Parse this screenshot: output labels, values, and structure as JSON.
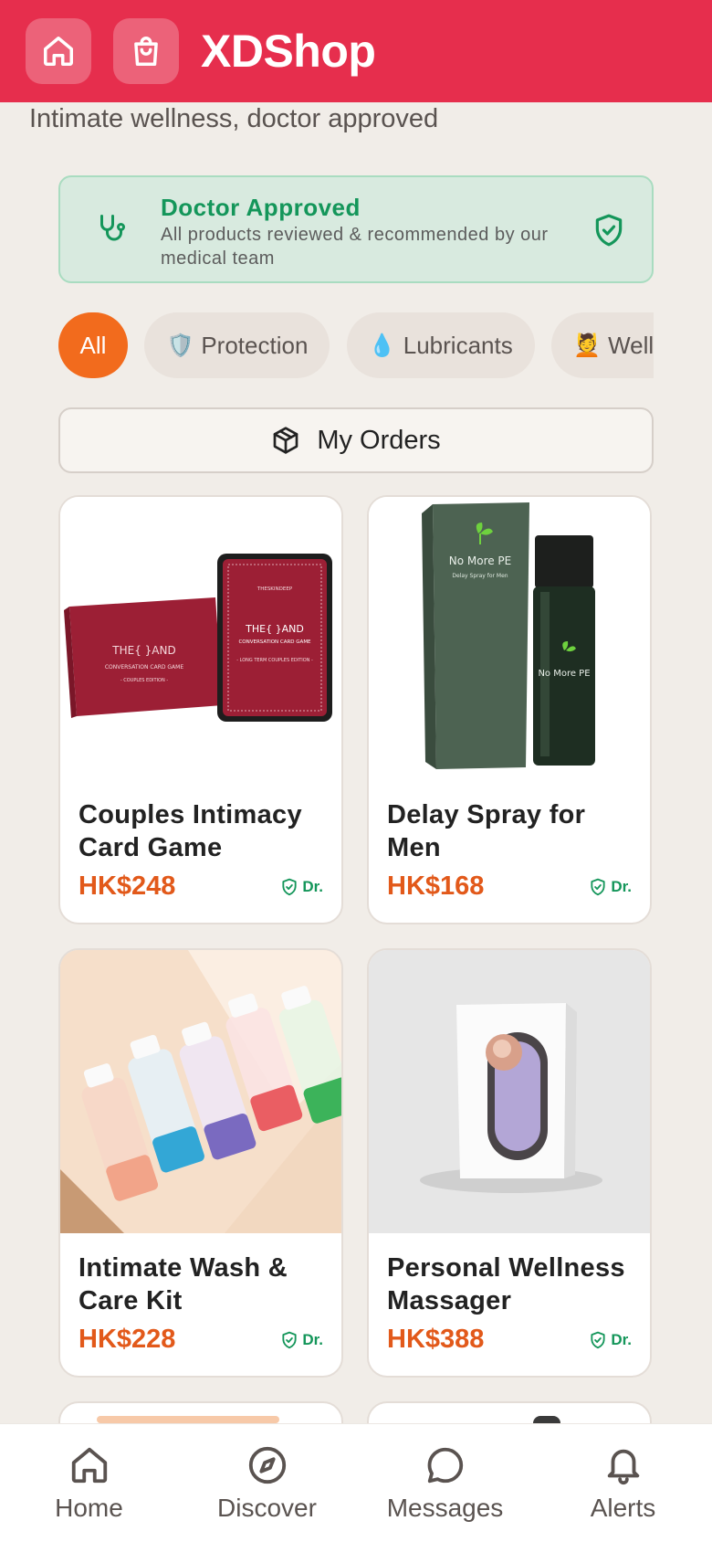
{
  "header": {
    "title": "XDShop",
    "home_icon": "home-icon",
    "bag_icon": "shopping-bag-icon",
    "color": "#e62e4d"
  },
  "subtitle": "Intimate wellness, doctor approved",
  "banner": {
    "title": "Doctor Approved",
    "description": "All products reviewed & recommended by our medical team",
    "icon_left": "stethoscope-icon",
    "icon_right": "shield-check-icon"
  },
  "categories": [
    {
      "label": "All",
      "emoji": "",
      "active": true
    },
    {
      "label": "Protection",
      "emoji": "🛡️",
      "active": false
    },
    {
      "label": "Lubricants",
      "emoji": "💧",
      "active": false
    },
    {
      "label": "Wellness",
      "emoji": "💆",
      "active": false
    }
  ],
  "orders": {
    "label": "My Orders",
    "icon": "package-icon"
  },
  "products": [
    {
      "name": "Couples Intimacy Card Game",
      "price": "HK$248",
      "badge": "Dr."
    },
    {
      "name": "Delay Spray for Men",
      "price": "HK$168",
      "badge": "Dr."
    },
    {
      "name": "Intimate Wash & Care Kit",
      "price": "HK$228",
      "badge": "Dr."
    },
    {
      "name": "Personal Wellness Massager",
      "price": "HK$388",
      "badge": "Dr."
    }
  ],
  "product_images": {
    "card_game_box": "THE{   }AND",
    "card_game_sub": "CONVERSATION CARD GAME",
    "card_game_edition": "- COUPLES EDITION -",
    "card_game_card_edition": "- LONG TERM COUPLES EDITION -",
    "card_game_brand": "THESKINDEEP",
    "spray_brand": "No More PE",
    "spray_sub": "Delay Spray for Men"
  },
  "nav": [
    {
      "label": "Home",
      "icon": "home-icon"
    },
    {
      "label": "Discover",
      "icon": "compass-icon"
    },
    {
      "label": "Messages",
      "icon": "chat-bubble-icon"
    },
    {
      "label": "Alerts",
      "icon": "bell-icon"
    }
  ]
}
